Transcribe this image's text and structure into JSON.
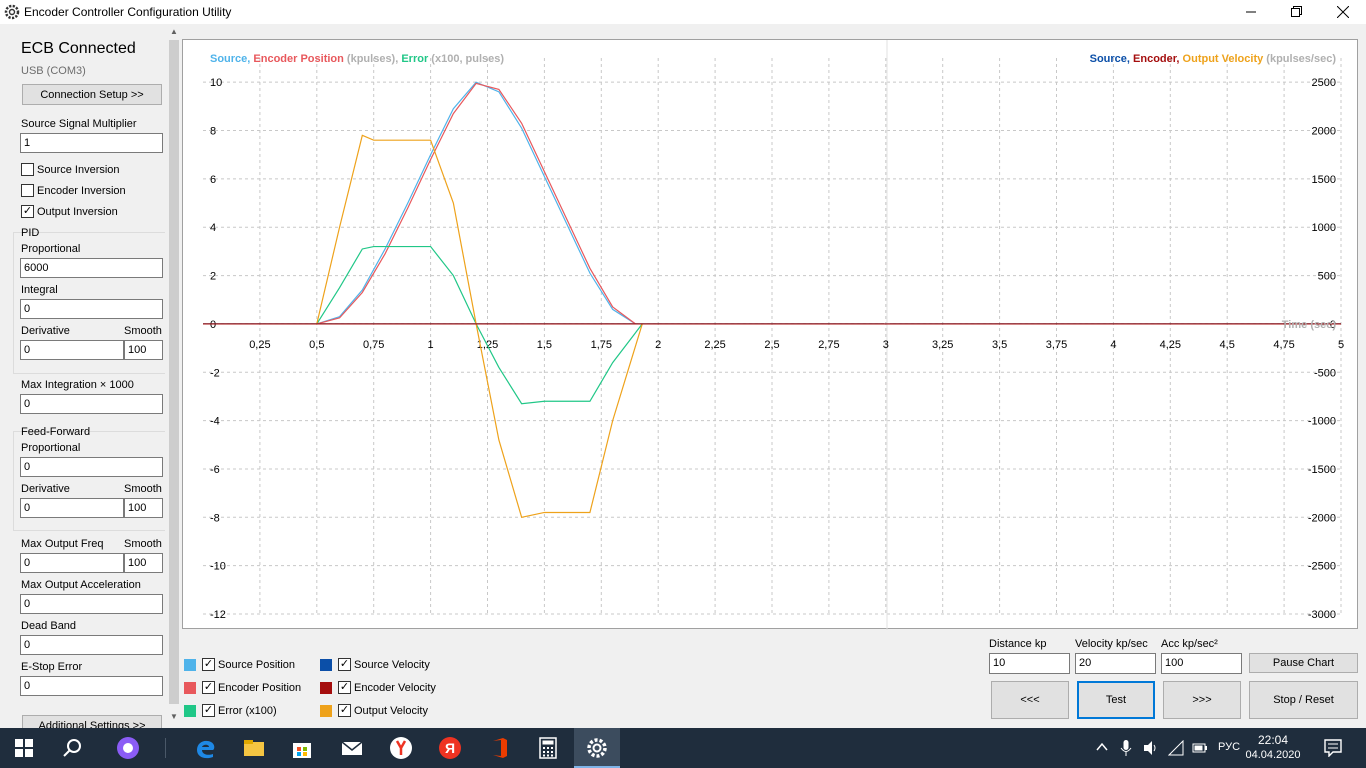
{
  "window": {
    "title": "Encoder Controller Configuration Utility"
  },
  "connection": {
    "status": "ECB Connected",
    "port": "USB (COM3)",
    "setup_button": "Connection Setup >>"
  },
  "settings": {
    "source_multiplier_label": "Source Signal Multiplier",
    "source_multiplier_value": "1",
    "source_inversion_label": "Source Inversion",
    "source_inversion_checked": false,
    "encoder_inversion_label": "Encoder Inversion",
    "encoder_inversion_checked": false,
    "output_inversion_label": "Output Inversion",
    "output_inversion_checked": true,
    "pid_label": "PID",
    "pid_proportional_label": "Proportional",
    "pid_proportional_value": "6000",
    "pid_integral_label": "Integral",
    "pid_integral_value": "0",
    "pid_derivative_label": "Derivative",
    "pid_derivative_value": "0",
    "pid_smooth_label": "Smooth",
    "pid_smooth_value": "100",
    "max_integration_label": "Max Integration × 1000",
    "max_integration_value": "0",
    "ff_label": "Feed-Forward",
    "ff_proportional_label": "Proportional",
    "ff_proportional_value": "0",
    "ff_derivative_label": "Derivative",
    "ff_derivative_value": "0",
    "ff_smooth_label": "Smooth",
    "ff_smooth_value": "100",
    "max_output_freq_label": "Max Output Freq",
    "max_output_freq_value": "0",
    "max_output_freq_smooth_label": "Smooth",
    "max_output_freq_smooth_value": "100",
    "max_output_acc_label": "Max Output Acceleration",
    "max_output_acc_value": "0",
    "dead_band_label": "Dead Band",
    "dead_band_value": "0",
    "estop_label": "E-Stop Error",
    "estop_value": "0",
    "additional_button": "Additional Settings >>"
  },
  "legend": {
    "source_position": "Source Position",
    "encoder_position": "Encoder Position",
    "error": "Error (x100)",
    "source_velocity": "Source Velocity",
    "encoder_velocity": "Encoder Velocity",
    "output_velocity": "Output Velocity"
  },
  "controls": {
    "distance_label": "Distance kp",
    "distance_value": "10",
    "velocity_label": "Velocity kp/sec",
    "velocity_value": "20",
    "acc_label": "Acc  kp/sec²",
    "acc_value": "100",
    "pause_button": "Pause Chart",
    "back_button": "<<<",
    "test_button": "Test",
    "forward_button": ">>>",
    "stop_button": "Stop / Reset"
  },
  "colors": {
    "source_position": "#4fb3ea",
    "encoder_position": "#e8585c",
    "error": "#20c787",
    "source_velocity": "#0b4fa8",
    "encoder_velocity": "#a50e0e",
    "output_velocity": "#eea21b"
  },
  "chart_data": {
    "type": "line",
    "left_title": {
      "source": "Source, ",
      "encoder": "Encoder Position",
      "units1": " (kpulses), ",
      "error": "Error",
      "units2": " (x100, pulses)"
    },
    "right_title": {
      "source": "Source, ",
      "encoder": "Encoder, ",
      "output": "Output Velocity",
      "units": " (kpulses/sec)"
    },
    "xlabel": "Time (sec)",
    "xlim": [
      0,
      5
    ],
    "ylim_left": [
      -12,
      11
    ],
    "ylim_right": [
      -3000,
      2750
    ],
    "x_ticks": [
      "0,25",
      "0,5",
      "0,75",
      "1",
      "1,25",
      "1,5",
      "1,75",
      "2",
      "2,25",
      "2,5",
      "2,75",
      "3",
      "3,25",
      "3,5",
      "3,75",
      "4",
      "4,25",
      "4,5",
      "4,75",
      "5"
    ],
    "x_tick_values": [
      0.25,
      0.5,
      0.75,
      1,
      1.25,
      1.5,
      1.75,
      2,
      2.25,
      2.5,
      2.75,
      3,
      3.25,
      3.5,
      3.75,
      4,
      4.25,
      4.5,
      4.75,
      5
    ],
    "y_left_ticks": [
      10,
      8,
      6,
      4,
      2,
      0,
      -2,
      -4,
      -6,
      -8,
      -10,
      -12
    ],
    "y_right_ticks": [
      2500,
      2000,
      1500,
      1000,
      500,
      0,
      -500,
      -1000,
      -1500,
      -2000,
      -2500,
      -3000
    ],
    "series": [
      {
        "name": "Source Position",
        "axis": "left",
        "color_key": "source_position",
        "x": [
          0.5,
          0.6,
          0.7,
          0.8,
          0.9,
          1.0,
          1.1,
          1.2,
          1.3,
          1.4,
          1.5,
          1.6,
          1.7,
          1.8,
          1.9
        ],
        "y": [
          0,
          0.3,
          1.4,
          3.1,
          5.0,
          7.0,
          8.9,
          10,
          9.6,
          8.1,
          6.1,
          4.1,
          2.1,
          0.6,
          0
        ]
      },
      {
        "name": "Encoder Position",
        "axis": "left",
        "color_key": "encoder_position",
        "x": [
          0.5,
          0.6,
          0.7,
          0.8,
          0.9,
          1.0,
          1.1,
          1.2,
          1.3,
          1.4,
          1.5,
          1.6,
          1.7,
          1.8,
          1.9
        ],
        "y": [
          0,
          0.25,
          1.3,
          2.9,
          4.8,
          6.8,
          8.7,
          9.95,
          9.7,
          8.3,
          6.3,
          4.3,
          2.3,
          0.7,
          0
        ]
      },
      {
        "name": "Error (x100)",
        "axis": "left",
        "color_key": "error",
        "x": [
          0.5,
          0.6,
          0.7,
          0.75,
          1.0,
          1.1,
          1.2,
          1.3,
          1.4,
          1.5,
          1.6,
          1.7,
          1.8,
          1.93
        ],
        "y": [
          0,
          1.5,
          3.1,
          3.2,
          3.2,
          2.0,
          0,
          -1.8,
          -3.3,
          -3.2,
          -3.2,
          -3.2,
          -1.6,
          0
        ]
      },
      {
        "name": "Output Velocity",
        "axis": "right",
        "color_key": "output_velocity",
        "x": [
          0.5,
          0.6,
          0.7,
          0.75,
          1.0,
          1.1,
          1.2,
          1.3,
          1.4,
          1.5,
          1.6,
          1.7,
          1.8,
          1.93
        ],
        "y": [
          0,
          1000,
          1950,
          1900,
          1900,
          1250,
          0,
          -1200,
          -2000,
          -1950,
          -1950,
          -1950,
          -1000,
          0
        ]
      },
      {
        "name": "Source Velocity",
        "axis": "right",
        "color_key": "source_velocity",
        "x": [
          0,
          5
        ],
        "y": [
          0,
          0
        ]
      },
      {
        "name": "Encoder Velocity",
        "axis": "right",
        "color_key": "encoder_velocity",
        "x": [
          0,
          5
        ],
        "y": [
          0,
          0
        ]
      }
    ]
  },
  "taskbar": {
    "lang": "РУС",
    "time": "22:04",
    "date": "04.04.2020"
  }
}
